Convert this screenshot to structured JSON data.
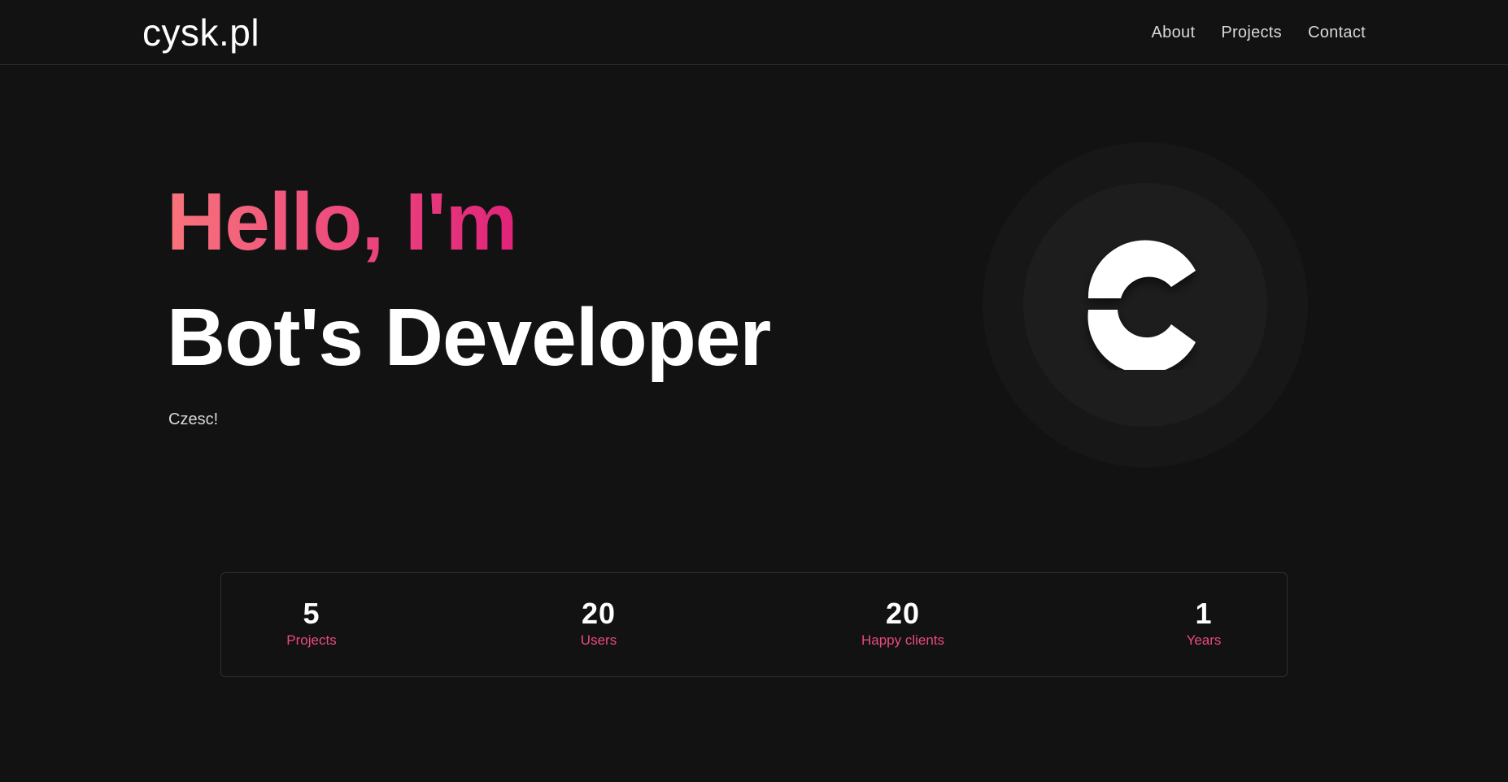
{
  "header": {
    "brand": "cysk.pl",
    "nav": [
      {
        "label": "About"
      },
      {
        "label": "Projects"
      },
      {
        "label": "Contact"
      }
    ]
  },
  "hero": {
    "greeting": "Hello, I'm",
    "role": "Bot's Developer",
    "subtitle": "Czesc!"
  },
  "stats": [
    {
      "value": "5",
      "label": "Projects"
    },
    {
      "value": "20",
      "label": "Users"
    },
    {
      "value": "20",
      "label": "Happy clients"
    },
    {
      "value": "1",
      "label": "Years"
    }
  ],
  "colors": {
    "background": "#121212",
    "accent": "#ea4b7c",
    "gradient_start": "#f8737b",
    "gradient_end": "#e0237a"
  },
  "icons": {
    "logo": "c-logo-icon"
  }
}
